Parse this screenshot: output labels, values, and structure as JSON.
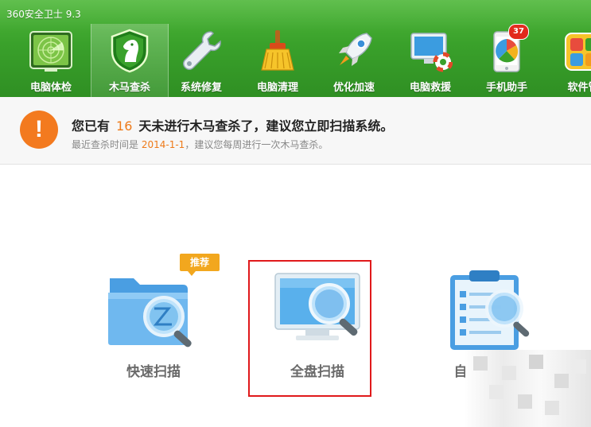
{
  "app": {
    "title": "360安全卫士 9.3"
  },
  "tabs": [
    {
      "label": "电脑体检",
      "icon": "radar-icon",
      "active": false
    },
    {
      "label": "木马查杀",
      "icon": "horse-shield-icon",
      "active": true
    },
    {
      "label": "系统修复",
      "icon": "wrench-icon",
      "active": false
    },
    {
      "label": "电脑清理",
      "icon": "broom-icon",
      "active": false
    },
    {
      "label": "优化加速",
      "icon": "rocket-icon",
      "active": false
    },
    {
      "label": "电脑救援",
      "icon": "monitor-lifebuoy-icon",
      "active": false
    },
    {
      "label": "手机助手",
      "icon": "phone-icon",
      "active": false,
      "badge": "37"
    },
    {
      "label": "软件管",
      "icon": "software-icon",
      "active": false
    }
  ],
  "notice": {
    "icon": "exclamation-icon",
    "prefix": "您已有",
    "days": "16",
    "suffix": "天未进行木马查杀了，建议您立即扫描系统。",
    "sub_prefix": "最近查杀时间是",
    "last_date": "2014-1-1",
    "sub_suffix": "，建议您每周进行一次木马查杀。"
  },
  "scan_options": {
    "quick": {
      "label": "快速扫描",
      "tag": "推荐",
      "icon": "folder-magnifier-icon"
    },
    "full": {
      "label": "全盘扫描",
      "icon": "monitor-magnifier-icon",
      "highlighted": true
    },
    "custom": {
      "label": "自定义扫描",
      "icon": "clipboard-magnifier-icon",
      "partially_obscured": true
    }
  },
  "colors": {
    "header_green": "#3aa12b",
    "accent_orange": "#ee7a19",
    "warning_orange": "#f37a1f",
    "highlight_red": "#e0191b",
    "tag_orange": "#f2a71e"
  }
}
